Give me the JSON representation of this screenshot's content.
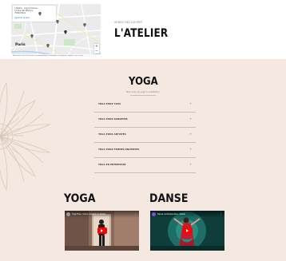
{
  "map": {
    "info_lines": [
      "L'Atelier - Yoga & Danse",
      "47 Rue des Martyrs",
      "75009 Paris"
    ],
    "info_link": "Agrandir le plan",
    "city_label": "Paris",
    "footer": "Raccourcis clavier  Données cartographiques  Conditions d'utilisation  Signaler une erreur",
    "zoom_in": "+",
    "zoom_out": "−"
  },
  "header": {
    "kicker": "VENEZ DÉCOUVRIR",
    "title": "L'ATELIER"
  },
  "yoga": {
    "title": "YOGA",
    "subtitle": "Nos cours de yoga & méditation",
    "items": [
      {
        "label": "YOGA POUR TOUS"
      },
      {
        "label": "YOGA POUR DANSEURS"
      },
      {
        "label": "YOGA POUR ARTISTES"
      },
      {
        "label": "YOGA POUR FEMMES ENCEINTES"
      },
      {
        "label": "YOGA EN ENTREPRISE"
      }
    ]
  },
  "sections": {
    "yoga_heading": "YOGA",
    "danse_heading": "DANSE"
  },
  "videos": [
    {
      "title": "Yoga Flow - Cours complet à L'Atelier",
      "channel_color": "#9a9a9a"
    },
    {
      "title": "Danse contemporaine - Atelier",
      "channel_color": "#7b4fd8"
    }
  ],
  "colors": {
    "background": "#f4e8e0",
    "play_button": "#ff0000"
  }
}
